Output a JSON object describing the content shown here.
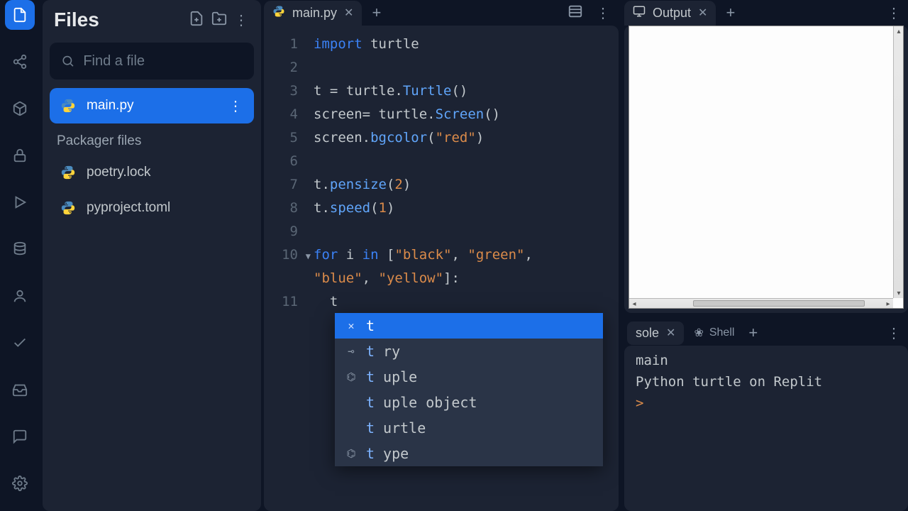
{
  "sidebar_icons": [
    "files",
    "share",
    "package",
    "lock",
    "run",
    "database",
    "user",
    "check",
    "inbox",
    "chat",
    "settings"
  ],
  "files": {
    "title": "Files",
    "search_placeholder": "Find a file",
    "active_file": "main.py",
    "section_label": "Packager files",
    "other_files": [
      "poetry.lock",
      "pyproject.toml"
    ]
  },
  "editor": {
    "tab_label": "main.py",
    "lines": [
      "1",
      "2",
      "3",
      "4",
      "5",
      "6",
      "7",
      "8",
      "9",
      "10",
      "11"
    ],
    "code_tokens": [
      [
        [
          "kw",
          "import"
        ],
        [
          "",
          " turtle"
        ]
      ],
      [],
      [
        [
          "",
          "t = turtle."
        ],
        [
          "fn",
          "Turtle"
        ],
        [
          "",
          "()"
        ]
      ],
      [
        [
          "",
          "screen= turtle."
        ],
        [
          "fn",
          "Screen"
        ],
        [
          "",
          "()"
        ]
      ],
      [
        [
          "",
          "screen."
        ],
        [
          "fn",
          "bgcolor"
        ],
        [
          "",
          "("
        ],
        [
          "str",
          "\"red\""
        ],
        [
          "",
          ")"
        ]
      ],
      [],
      [
        [
          "",
          "t."
        ],
        [
          "fn",
          "pensize"
        ],
        [
          "",
          "("
        ],
        [
          "num",
          "2"
        ],
        [
          "",
          ")"
        ]
      ],
      [
        [
          "",
          "t."
        ],
        [
          "fn",
          "speed"
        ],
        [
          "",
          "("
        ],
        [
          "num",
          "1"
        ],
        [
          "",
          ")"
        ]
      ],
      [],
      [
        [
          "kw",
          "for"
        ],
        [
          "",
          " i "
        ],
        [
          "kw",
          "in"
        ],
        [
          "",
          " ["
        ],
        [
          "str",
          "\"black\""
        ],
        [
          "",
          ", "
        ],
        [
          "str",
          "\"green\""
        ],
        [
          "",
          ", "
        ]
      ],
      [
        [
          "str",
          "\"blue\""
        ],
        [
          "",
          ", "
        ],
        [
          "str",
          "\"yellow\""
        ],
        [
          "",
          "]:"
        ]
      ],
      [
        [
          "",
          "  t"
        ]
      ]
    ],
    "fold_line": 10,
    "autocomplete": [
      {
        "icon": "x",
        "prefix": "t",
        "rest": "",
        "selected": true
      },
      {
        "icon": "key",
        "prefix": "t",
        "rest": "ry"
      },
      {
        "icon": "struct",
        "prefix": "t",
        "rest": "uple"
      },
      {
        "icon": "",
        "prefix": "t",
        "rest": "uple object"
      },
      {
        "icon": "",
        "prefix": "t",
        "rest": "urtle"
      },
      {
        "icon": "struct",
        "prefix": "t",
        "rest": "ype"
      }
    ]
  },
  "output": {
    "tab_label": "Output"
  },
  "console": {
    "tab1": "sole",
    "tab2": "Shell",
    "line1": "main",
    "line2": "Python turtle on Replit",
    "prompt": ">"
  }
}
